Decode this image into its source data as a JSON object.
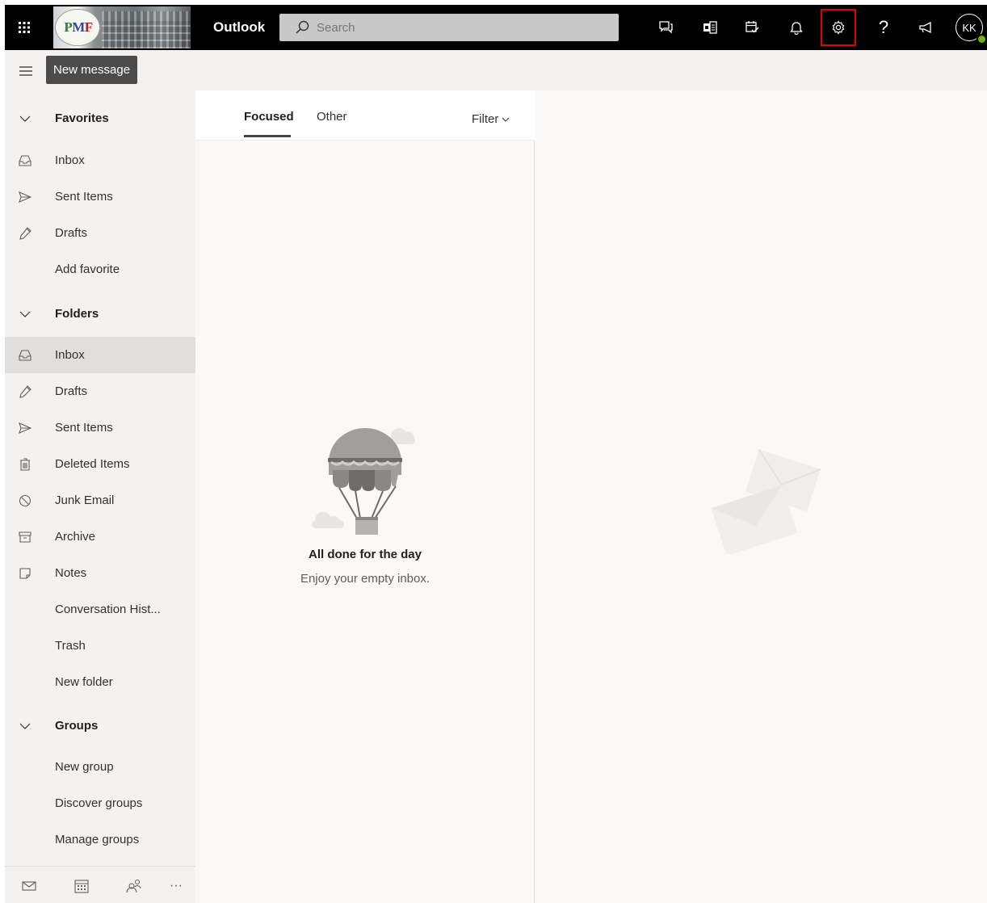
{
  "header": {
    "app_name": "Outlook",
    "logo_text": "PMF",
    "search_placeholder": "Search",
    "user_initials": "KK",
    "presence_color": "#6bb700",
    "icons": [
      "app-launcher-icon",
      "skype-chat-icon",
      "office-apps-icon",
      "my-day-icon",
      "notifications-icon",
      "settings-icon",
      "help-icon",
      "feedback-icon"
    ],
    "highlight_color": "#e00000"
  },
  "command_bar": {
    "new_message_label": "New message"
  },
  "sidebar": {
    "favorites_label": "Favorites",
    "favorites": [
      {
        "label": "Inbox",
        "icon": "inbox-icon"
      },
      {
        "label": "Sent Items",
        "icon": "send-icon"
      },
      {
        "label": "Drafts",
        "icon": "pencil-icon"
      },
      {
        "label": "Add favorite",
        "icon": ""
      }
    ],
    "folders_label": "Folders",
    "folders": [
      {
        "label": "Inbox",
        "icon": "inbox-icon",
        "selected": true
      },
      {
        "label": "Drafts",
        "icon": "pencil-icon"
      },
      {
        "label": "Sent Items",
        "icon": "send-icon"
      },
      {
        "label": "Deleted Items",
        "icon": "trash-icon"
      },
      {
        "label": "Junk Email",
        "icon": "block-icon"
      },
      {
        "label": "Archive",
        "icon": "archive-icon"
      },
      {
        "label": "Notes",
        "icon": "note-icon"
      },
      {
        "label": "Conversation Hist...",
        "icon": ""
      },
      {
        "label": "Trash",
        "icon": ""
      },
      {
        "label": "New folder",
        "icon": ""
      }
    ],
    "groups_label": "Groups",
    "groups": [
      {
        "label": "New group"
      },
      {
        "label": "Discover groups"
      },
      {
        "label": "Manage groups"
      }
    ],
    "footer_icons": [
      "mail-icon",
      "calendar-icon",
      "people-icon",
      "more-icon"
    ],
    "more_glyph": "···"
  },
  "message_list": {
    "tabs": [
      {
        "label": "Focused",
        "active": true
      },
      {
        "label": "Other",
        "active": false
      }
    ],
    "filter_label": "Filter",
    "empty_title": "All done for the day",
    "empty_subtitle": "Enjoy your empty inbox."
  }
}
